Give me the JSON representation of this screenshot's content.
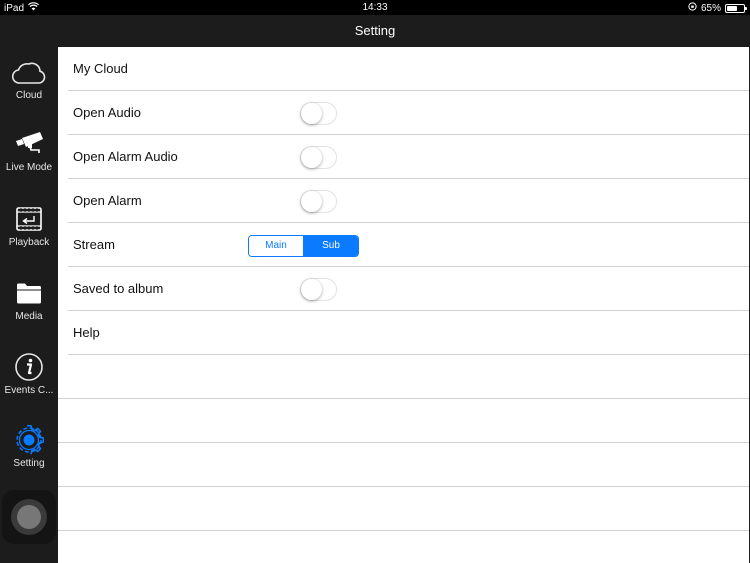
{
  "status_bar": {
    "device": "iPad",
    "wifi_icon": "wifi-icon",
    "time": "14:33",
    "orientation_lock_icon": "orientation-lock-icon",
    "battery_percent": "65%",
    "battery_level": 0.65
  },
  "nav_bar": {
    "title": "Setting"
  },
  "sidebar": {
    "tabs": [
      {
        "label": "Cloud",
        "icon": "cloud-icon",
        "active": false
      },
      {
        "label": "Live Mode",
        "icon": "camera-icon",
        "active": false
      },
      {
        "label": "Playback",
        "icon": "playback-icon",
        "active": false
      },
      {
        "label": "Media",
        "icon": "folder-icon",
        "active": false
      },
      {
        "label": "Events C...",
        "icon": "info-icon",
        "active": false
      },
      {
        "label": "Setting",
        "icon": "gear-icon",
        "active": true
      }
    ],
    "active_color": "#0a7aff"
  },
  "settings": {
    "rows": [
      {
        "title": "My Cloud",
        "control": "none"
      },
      {
        "title": "Open Audio",
        "control": "toggle",
        "value": false
      },
      {
        "title": "Open Alarm Audio",
        "control": "toggle",
        "value": false
      },
      {
        "title": "Open Alarm",
        "control": "toggle",
        "value": false
      },
      {
        "title": "Stream",
        "control": "segmented",
        "options": [
          "Main",
          "Sub"
        ],
        "selected": "Sub"
      },
      {
        "title": "Saved to album",
        "control": "toggle",
        "value": false
      },
      {
        "title": "Help",
        "control": "none"
      }
    ]
  },
  "colors": {
    "accent": "#0a7aff",
    "chrome": "#1c1c1c",
    "status_bar": "#000000"
  }
}
